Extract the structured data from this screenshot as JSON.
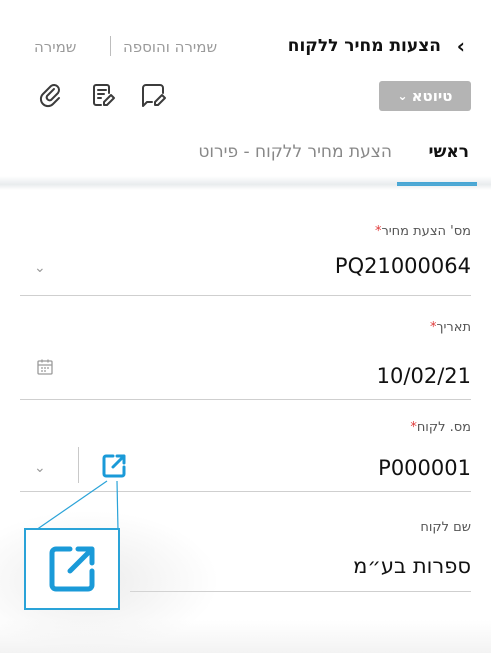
{
  "header": {
    "title": "הצעות מחיר ללקוח",
    "save_add_label": "שמירה והוספה",
    "save_label": "שמירה",
    "status": "טיוטא"
  },
  "tabs": [
    {
      "label": "ראשי",
      "active": true
    },
    {
      "label": "הצעת מחיר ללקוח - פירוט",
      "active": false
    }
  ],
  "fields": {
    "quote_number": {
      "label": "מס' הצעת מחיר",
      "value": "PQ21000064"
    },
    "date": {
      "label": "תאריך",
      "value": "10/02/21"
    },
    "customer_number": {
      "label": "מס. לקוח",
      "value": "P000001"
    },
    "customer_name": {
      "label": "שם לקוח",
      "value": "ספרות בע״מ"
    }
  },
  "required_mark": "*",
  "colors": {
    "accent": "#1a9ad8",
    "required": "#e03a3a",
    "status_bg": "#b4b4b4"
  },
  "icons": [
    "back-chevron-icon",
    "attachment-icon",
    "notes-icon",
    "comment-icon",
    "chevron-down-icon",
    "calendar-icon",
    "open-external-icon"
  ]
}
